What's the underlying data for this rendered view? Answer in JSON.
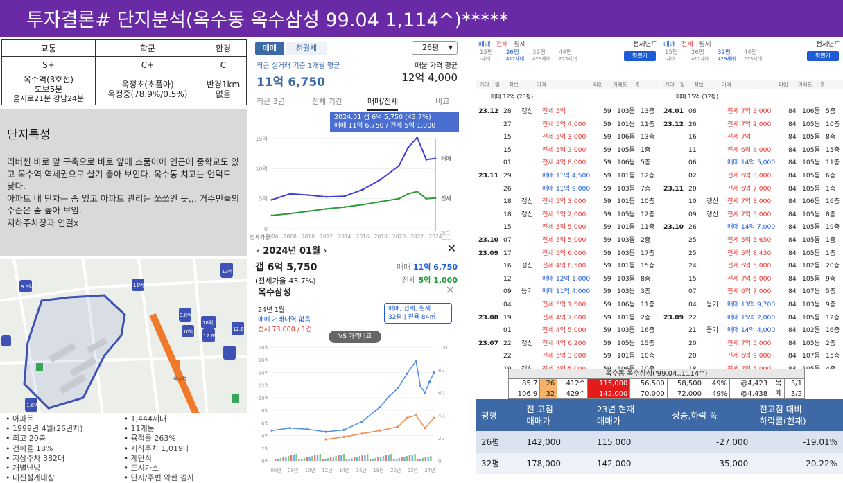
{
  "title": "투자결론# 단지분석(옥수동 옥수삼성 99.04 1,114^)*****",
  "ratings": {
    "headers": [
      "교통",
      "학군",
      "환경"
    ],
    "grades": [
      "S+",
      "C+",
      "C"
    ],
    "details": [
      [
        "옥수역(3호선)",
        "도보5분",
        "을지로21분 강남24분"
      ],
      [
        "옥정초(초품아)",
        "옥정중(78.9%/0.5%)"
      ],
      [
        "반경1km",
        "없음"
      ]
    ]
  },
  "traits": {
    "heading": "단지특성",
    "text": "리버젠 바로 앞 구축으로 바로 앞에 초품아에 인근에 중학교도 있고 옥수역 역세권으로 살기 좋아 보인다. 옥수동 치고는 언덕도 낮다.\n아파트 내 단차는 좀 있고 아파트 관리는 쏘쏘인 듯,,, 거주민들의 수준은 좀 높아 보임.\n지하주차장과 연결x"
  },
  "summary": [
    "아파트",
    "1,444세대",
    "1999년 4월(26년차)",
    "11개동",
    "최고 20층",
    "용적률 263%",
    "건폐율 18%",
    "지하주차 1,019대",
    "지상주차 382대",
    "계단식",
    "개별난방",
    "도시가스",
    "내진설계대상",
    "단지/주변 약한 경사"
  ],
  "map": {
    "labels": [
      "9.5억",
      "11억",
      "13억",
      "9.8억",
      "10억",
      "18억",
      "17.6억",
      "12.6억",
      "1.6억",
      "옥수역",
      "옥수역"
    ]
  },
  "panelA": {
    "tab_sale": "매매",
    "tab_rent": "전월세",
    "size": "26평",
    "recent_label": "최근 실거래 기준 1개월 평균",
    "recent_value": "11억 6,750",
    "ask_label": "매물 가격 평균",
    "ask_value": "12억 4,000",
    "tabs": [
      "최근 3년",
      "전체 기간",
      "매매/전세",
      "비교"
    ],
    "tooltip1": "2024.01 갭 6억 5,750 (43.7%)",
    "tooltip2": "매매 11억 6,750 / 전세 5억 1,000",
    "y_labels": [
      "15억",
      "10억",
      "5억",
      "0"
    ],
    "x_labels": [
      "2006",
      "2008",
      "2010",
      "2012",
      "2014",
      "2016",
      "2018",
      "2020",
      "2022",
      "2024"
    ],
    "legend": [
      "매매",
      "전세",
      "평균",
      "59%"
    ],
    "gap_label": "전세가율"
  },
  "chart_data": {
    "type": "line",
    "title": "",
    "x": [
      2006,
      2008,
      2010,
      2012,
      2014,
      2016,
      2018,
      2020,
      2021,
      2022,
      2023,
      2024
    ],
    "series": [
      {
        "name": "매매",
        "values": [
          4.8,
          5.8,
          5.6,
          5.3,
          5.4,
          6.5,
          8.2,
          10.5,
          13.5,
          15.2,
          11.5,
          11.7
        ]
      },
      {
        "name": "전세",
        "values": [
          2.2,
          2.5,
          2.9,
          3.3,
          3.6,
          4.0,
          4.5,
          5.0,
          5.8,
          6.2,
          5.0,
          5.1
        ]
      }
    ],
    "ylabel": "",
    "ylim": [
      0,
      15
    ]
  },
  "panelB": {
    "month": "2024년 01월",
    "gap": "갭 6억 5,750",
    "ratio": "(전세가율 43.7%)",
    "sale_label": "매매",
    "sale_val": "11억 6,750",
    "jeonse_label": "전세",
    "jeonse_val": "5억 1,000",
    "name": "옥수삼성",
    "month2": "24년 1월",
    "no_deal": "매매 거래내역 없음",
    "jeonse_line": "전세 73,000 / 1건",
    "btn_line1": "매매, 전세, 월세",
    "btn_line2": "32평 | 전용 84㎡",
    "vs": "VS 가격비교",
    "y_left": [
      "18억",
      "16억",
      "14억",
      "12억",
      "10억",
      "8억",
      "6억",
      "4억",
      "2억",
      "0억"
    ],
    "y_right": [
      "100",
      "80",
      "60",
      "40",
      "20",
      "0"
    ],
    "x_labels": [
      "06년",
      "08년",
      "10년",
      "12년",
      "14년",
      "16년",
      "18년",
      "20년",
      "22년",
      "24년"
    ]
  },
  "left_list": {
    "tabs": [
      "매매",
      "전세",
      "월세"
    ],
    "year": "전체년도",
    "sizes": [
      [
        "15평",
        "-세대"
      ],
      [
        "26평",
        "412세대"
      ],
      [
        "32평",
        "429세대"
      ],
      [
        "44평",
        "273세대"
      ]
    ],
    "btn": "평뽑기",
    "hdr": [
      "계약",
      "일",
      "정보",
      "가격",
      "타입",
      "거래동",
      "층"
    ],
    "pic": "매매 12억 (26평)",
    "rows": [
      [
        "23.12",
        "28",
        "갱신",
        "전세 5억",
        "59",
        "103동",
        "13층"
      ],
      [
        "",
        "27",
        "",
        "전세 5억 4,000",
        "59",
        "101동",
        "11층"
      ],
      [
        "",
        "15",
        "",
        "전세 5억 3,000",
        "59",
        "106동",
        "13층"
      ],
      [
        "",
        "15",
        "",
        "전세 5억 3,000",
        "59",
        "105동",
        "1층"
      ],
      [
        "",
        "01",
        "",
        "전세 4억 8,000",
        "59",
        "106동",
        "5층"
      ],
      [
        "23.11",
        "29",
        "",
        "매매 11억 4,500",
        "59",
        "101동",
        "12층"
      ],
      [
        "",
        "26",
        "",
        "매매 11억 9,000",
        "59",
        "103동",
        "7층"
      ],
      [
        "",
        "18",
        "갱신",
        "전세 5억 3,000",
        "59",
        "101동",
        "10층"
      ],
      [
        "",
        "18",
        "갱신",
        "전세 5억 2,000",
        "59",
        "105동",
        "12층"
      ],
      [
        "",
        "15",
        "",
        "전세 5억 5,000",
        "59",
        "101동",
        "11층"
      ],
      [
        "23.10",
        "07",
        "",
        "전세 5억 5,000",
        "59",
        "103동",
        "2층"
      ],
      [
        "23.09",
        "17",
        "",
        "전세 5억 6,000",
        "59",
        "103동",
        "17층"
      ],
      [
        "",
        "16",
        "갱신",
        "전세 4억 8,500",
        "59",
        "101동",
        "15층"
      ],
      [
        "",
        "12",
        "",
        "매매 12억 1,000",
        "59",
        "103동",
        "8층"
      ],
      [
        "",
        "09",
        "등기",
        "매매 11억 4,000",
        "59",
        "103동",
        "3층"
      ],
      [
        "",
        "04",
        "",
        "전세 5억 1,500",
        "59",
        "106동",
        "11층"
      ],
      [
        "23.08",
        "19",
        "",
        "전세 4억 7,000",
        "59",
        "101동",
        "2층"
      ],
      [
        "",
        "01",
        "",
        "전세 4억 5,000",
        "59",
        "103동",
        "16층"
      ],
      [
        "23.07",
        "22",
        "갱신",
        "전세 4억 6,200",
        "59",
        "105동",
        "15층"
      ],
      [
        "",
        "22",
        "",
        "전세 5억 3,000",
        "59",
        "101동",
        "10층"
      ],
      [
        "",
        "19",
        "갱신",
        "전세 4억 5,000",
        "59",
        "106동",
        "10층"
      ]
    ]
  },
  "right_list": {
    "pic": "매매 15억 (32평)",
    "rows": [
      [
        "24.01",
        "08",
        "",
        "전세 7억 3,000",
        "84",
        "106동",
        "5층"
      ],
      [
        "23.12",
        "26",
        "",
        "전세 7억 2,000",
        "84",
        "105동",
        "10층"
      ],
      [
        "",
        "16",
        "",
        "전세 7억",
        "84",
        "105동",
        "8층"
      ],
      [
        "",
        "11",
        "",
        "전세 6억 8,000",
        "84",
        "105동",
        "15층"
      ],
      [
        "",
        "06",
        "",
        "매매 14억 5,000",
        "84",
        "105동",
        "11층"
      ],
      [
        "",
        "02",
        "",
        "전세 6억 8,000",
        "84",
        "105동",
        "6층"
      ],
      [
        "23.11",
        "20",
        "",
        "전세 6억 7,000",
        "84",
        "105동",
        "1층"
      ],
      [
        "",
        "10",
        "갱신",
        "전세 7억 3,000",
        "84",
        "106동",
        "16층"
      ],
      [
        "",
        "09",
        "갱신",
        "전세 7억 5,000",
        "84",
        "105동",
        "8층"
      ],
      [
        "23.10",
        "26",
        "",
        "매매 14억 7,000",
        "84",
        "105동",
        "19층"
      ],
      [
        "",
        "25",
        "",
        "전세 5억 5,650",
        "84",
        "105동",
        "1층"
      ],
      [
        "",
        "25",
        "",
        "전세 5억 8,430",
        "84",
        "105동",
        "1층"
      ],
      [
        "",
        "24",
        "",
        "전세 6억 5,000",
        "84",
        "102동",
        "20층"
      ],
      [
        "",
        "15",
        "",
        "전세 7억 6,000",
        "84",
        "105동",
        "9층"
      ],
      [
        "",
        "07",
        "",
        "전세 6억 7,000",
        "84",
        "107동",
        "5층"
      ],
      [
        "",
        "04",
        "등기",
        "매매 13억 9,700",
        "84",
        "103동",
        "9층"
      ],
      [
        "23.09",
        "22",
        "",
        "매매 15억 2,000",
        "84",
        "105동",
        "12층"
      ],
      [
        "",
        "21",
        "등기",
        "매매 14억 4,000",
        "84",
        "102동",
        "16층"
      ],
      [
        "",
        "20",
        "",
        "전세 7억 5,000",
        "84",
        "105동",
        "2층"
      ],
      [
        "",
        "20",
        "",
        "전세 6억 9,000",
        "84",
        "107동",
        "15층"
      ],
      [
        "",
        "18",
        "",
        "전세 7억 5,000",
        "84",
        "105동",
        "4층"
      ]
    ]
  },
  "calc": {
    "header": "옥수동 옥수삼성('99.04.,1114^)",
    "rows": [
      [
        "85.7",
        "26",
        "412^",
        "115,000",
        "56,500",
        "58,500",
        "49%",
        "@4,423",
        "목",
        "3/1"
      ],
      [
        "106.9",
        "32",
        "429^",
        "142,000",
        "70,000",
        "72,000",
        "49%",
        "@4,438",
        "계",
        "3/2"
      ]
    ]
  },
  "bottom": {
    "headers": [
      "평형",
      "전 고점\n매매가",
      "23년 현재\n매매가",
      "상승,하락 폭",
      "전고점 대비\n하락률(현재)"
    ],
    "rows": [
      [
        "26평",
        "142,000",
        "115,000",
        "-27,000",
        "-19.01%"
      ],
      [
        "32평",
        "178,000",
        "142,000",
        "-35,000",
        "-20.22%"
      ]
    ]
  }
}
